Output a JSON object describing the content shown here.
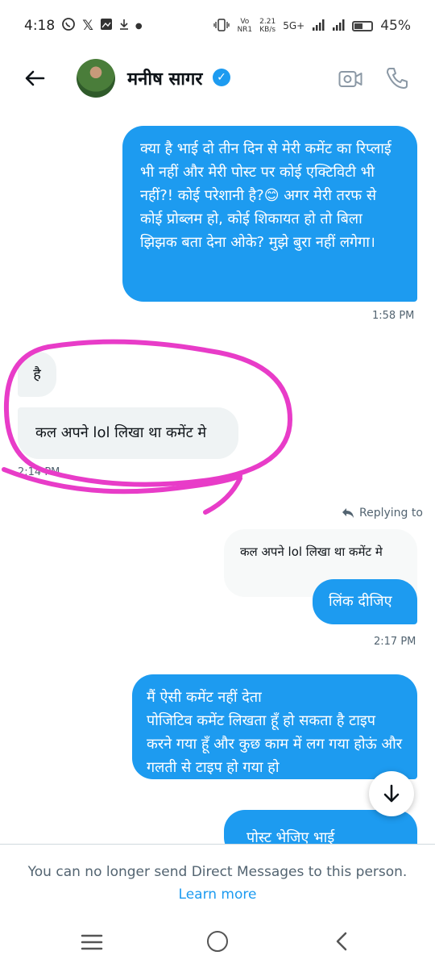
{
  "status_bar": {
    "time": "4:18",
    "net_top": "Vo",
    "net_bottom": "NR1",
    "speed_top": "2.21",
    "speed_bottom": "KB/s",
    "network": "5G+",
    "battery": "45%",
    "battery_level": 0.45
  },
  "header": {
    "contact_name": "मनीष सागर",
    "verified_mark": "✓"
  },
  "messages": {
    "m1": "क्या है भाई दो तीन दिन से मेरी कमेंट का रिप्लाई भी नहीं और मेरी पोस्ट पर कोई एक्टिविटी भी नहीं?! कोई परेशानी है?😊 अगर मेरी तरफ से कोई प्रोब्लम हो, कोई शिकायत हो तो बिला झिझक बता देना ओके? मुझे बुरा नहीं लगेगा।",
    "t1": "1:58 PM",
    "m2": "है",
    "m3": "कल अपने lol लिखा था कमेंट मे",
    "t2": "2:14 PM",
    "replying_label": "Replying to",
    "quoted": "कल अपने lol लिखा था कमेंट मे",
    "m5": "लिंक दीजिए",
    "t3": "2:17 PM",
    "m6": "मैं ऐसी कमेंट नहीं देता\nपोजिटिव कमेंट लिखता हूँ हो सकता है टाइप करने गया हूँ और कुछ काम में लग गया होऊं और गलती से टाइप हो गया हो",
    "m7": "पोस्ट भेजिए भाई"
  },
  "footer": {
    "notice": "You can no longer send Direct Messages to this person.",
    "link": "Learn more"
  },
  "colors": {
    "accent": "#1d9bf0",
    "incoming_bubble": "#eff3f4",
    "annotation": "#e83cc8"
  }
}
